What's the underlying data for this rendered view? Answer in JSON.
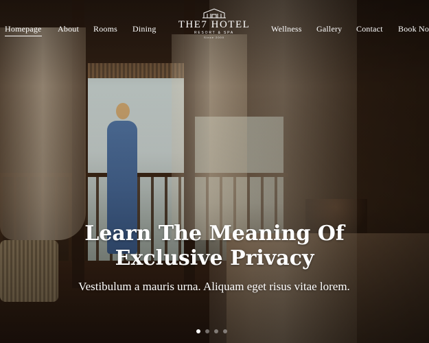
{
  "nav": {
    "left": [
      {
        "label": "Homepage",
        "active": true
      },
      {
        "label": "About"
      },
      {
        "label": "Rooms"
      },
      {
        "label": "Dining"
      }
    ],
    "right": [
      {
        "label": "Wellness"
      },
      {
        "label": "Gallery"
      },
      {
        "label": "Contact"
      },
      {
        "label": "Book Now"
      }
    ]
  },
  "logo": {
    "name": "THE7 HOTEL",
    "subtitle": "RESORT & SPA",
    "since": "Since 2000",
    "icon": "building-icon"
  },
  "hero": {
    "headline_line1": "Learn The Meaning Of",
    "headline_line2": "Exclusive Privacy",
    "subtext": "Vestibulum a mauris urna. Aliquam eget risus vitae lorem."
  },
  "carousel": {
    "slide_count": 4,
    "active_index": 0
  },
  "colors": {
    "text": "#ffffff",
    "background": "#2b1c12"
  }
}
